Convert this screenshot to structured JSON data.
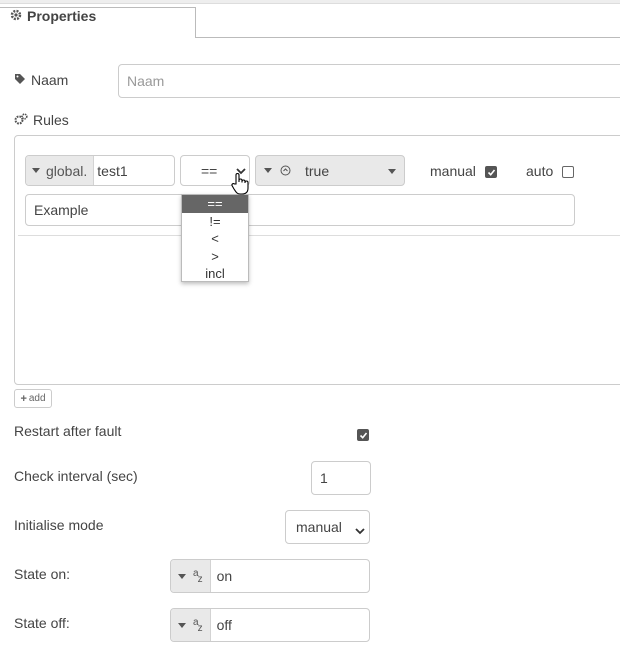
{
  "tab": {
    "label": "Properties",
    "icon": "gear-icon"
  },
  "name_field": {
    "label": "Naam",
    "placeholder": "Naam",
    "icon": "tag-icon"
  },
  "rules": {
    "label": "Rules",
    "icon": "gears-icon",
    "rule": {
      "type_prefix": "global.",
      "value": "test1",
      "operator": "==",
      "compare_type_icon": "boolean-icon",
      "compare_value": "true",
      "manual_label": "manual",
      "manual_checked": true,
      "auto_label": "auto",
      "auto_checked": false,
      "description": "Example"
    },
    "operator_options": [
      "==",
      "!=",
      "<",
      ">",
      "incl"
    ],
    "selected_operator_index": 0,
    "add_label": "add"
  },
  "restart_after_fault": {
    "label": "Restart after fault",
    "checked": true
  },
  "check_interval": {
    "label": "Check interval (sec)",
    "value": "1"
  },
  "initialise_mode": {
    "label": "Initialise mode",
    "value": "manual"
  },
  "state_on": {
    "label": "State on:",
    "type_icon": "string-az-icon",
    "value": "on"
  },
  "state_off": {
    "label": "State off:",
    "type_icon": "string-az-icon",
    "value": "off"
  }
}
